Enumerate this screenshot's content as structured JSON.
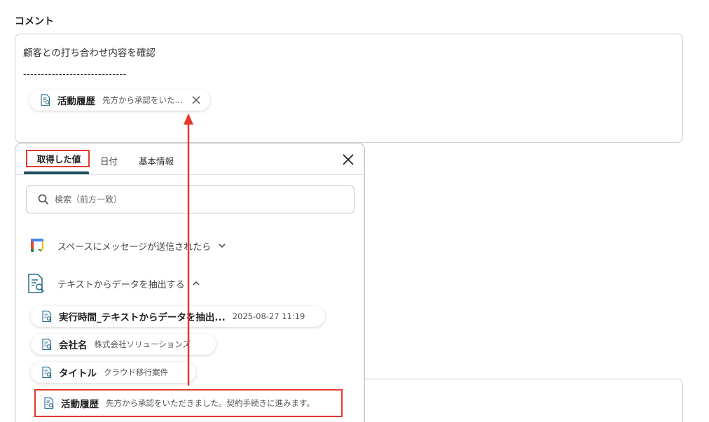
{
  "section": {
    "label": "コメント"
  },
  "comment": {
    "line1": "顧客との打ち合わせ内容を確認",
    "line2": "-----------------------------",
    "chip": {
      "icon": "document-search-icon",
      "name": "活動履歴",
      "value": "先方から承認をいた..."
    }
  },
  "panel": {
    "tabs": [
      {
        "label": "取得した値"
      },
      {
        "label": "日付"
      },
      {
        "label": "基本情報"
      }
    ],
    "search": {
      "placeholder": "検索（前方一致）"
    },
    "groups": [
      {
        "icon": "google-chat-icon",
        "label": "スペースにメッセージが送信されたら",
        "state": "collapsed"
      },
      {
        "icon": "document-search-icon",
        "label": "テキストからデータを抽出する",
        "state": "expanded"
      }
    ],
    "items": [
      {
        "icon": "document-search-icon",
        "name": "実行時間_テキストからデータを抽出...",
        "value": "2025-08-27 11:19"
      },
      {
        "icon": "document-search-icon",
        "name": "会社名",
        "value": "株式会社ソリューションズ"
      },
      {
        "icon": "document-search-icon",
        "name": "タイトル",
        "value": "クラウド移行案件"
      },
      {
        "icon": "document-search-icon",
        "name": "活動履歴",
        "value": "先方から承認をいただきました。契約手続きに進みます。"
      }
    ]
  },
  "colors": {
    "highlight": "#e53a2b",
    "tab_underline": "#1f4f63",
    "icon_blue": "#2f6f8f"
  }
}
